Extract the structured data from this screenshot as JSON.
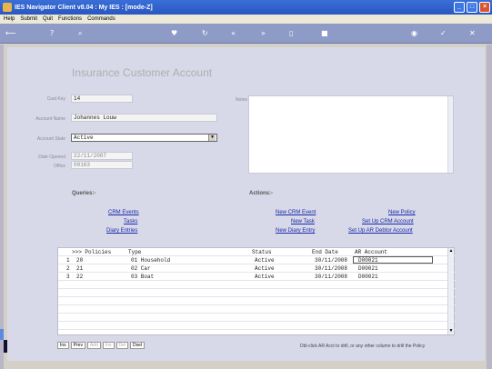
{
  "window": {
    "title": "IES Navigator Client v8.04 : My IES :      [mode-Z]",
    "buttons": [
      "_",
      "□",
      "×"
    ]
  },
  "menu": [
    "Help",
    "Submit",
    "Quit",
    "Functions",
    "Commands"
  ],
  "toolbar": {
    "icons": [
      "back-arrow-icon",
      "help-icon",
      "search-icon",
      "heart-icon",
      "refresh-icon",
      "rewind-icon",
      "forward-icon",
      "page-icon",
      "stop-icon",
      "globe-icon",
      "check-icon",
      "close-icon"
    ]
  },
  "form": {
    "title": "Insurance Customer Account",
    "cust_key_label": "Cust Key",
    "cust_key": "14",
    "account_name_label": "Account Name",
    "account_name": "Johannes Louw",
    "account_state_label": "Account State",
    "account_state": "Active",
    "date_opened_label": "Date Opened",
    "date_opened": "22/11/2007",
    "office_label": "Office",
    "office": "00163",
    "notes_label": "Notes"
  },
  "queries": {
    "heading": "Queries:-",
    "links": [
      "CRM Events",
      "Tasks",
      "Diary Entries"
    ]
  },
  "actions": {
    "heading": "Actions:-",
    "left_links": [
      "New CRM Event",
      "New Task",
      "New Diary Entry"
    ],
    "right_links": [
      "New Policy",
      "Set Up CRM Account",
      "Set Up AR Debtor Account"
    ]
  },
  "grid": {
    "headers": [
      ">>> Policies",
      "Type",
      "Status",
      "End Date",
      "AR Account"
    ],
    "rows": [
      {
        "n": "1",
        "policy": "20",
        "type": "01 Household",
        "status": "Active",
        "end": "30/11/2008",
        "ar": "D00021"
      },
      {
        "n": "2",
        "policy": "21",
        "type": "02 Car",
        "status": "Active",
        "end": "30/11/2008",
        "ar": "D00021"
      },
      {
        "n": "3",
        "policy": "22",
        "type": "03 Boat",
        "status": "Active",
        "end": "30/11/2008",
        "ar": "D00021"
      }
    ]
  },
  "nav": {
    "buttons": [
      "Ins",
      "Prev",
      "Add",
      "Ins",
      "Del",
      "Dsel"
    ],
    "hint": "Dbl-click AR Acct to drill, or any other column  to drill the Policy"
  },
  "colors": {
    "title_bar": "#2a56c0",
    "toolbar": "#8e9bc6",
    "page": "#d7d9e8",
    "link": "#1a2aa8"
  }
}
